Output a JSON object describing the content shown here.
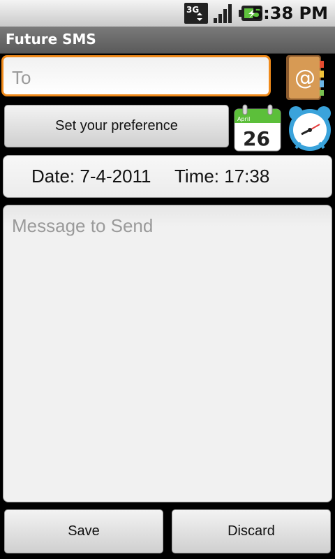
{
  "status_bar": {
    "time": "5:38 PM",
    "network_icon": "3g-icon",
    "signal_icon": "signal-icon",
    "battery_icon": "battery-charging-icon"
  },
  "app": {
    "title": "Future SMS"
  },
  "to_field": {
    "placeholder": "To"
  },
  "preference": {
    "button_label": "Set your preference"
  },
  "calendar": {
    "month": "April",
    "day": "26"
  },
  "schedule": {
    "date": "Date: 7-4-2011",
    "time": "Time: 17:38"
  },
  "message": {
    "placeholder": "Message to Send"
  },
  "actions": {
    "save_label": "Save",
    "discard_label": "Discard"
  },
  "colors": {
    "focus_border": "#f08a1a",
    "title_bar": "#6a6a6a",
    "calendar_green": "#5cbf3a"
  }
}
